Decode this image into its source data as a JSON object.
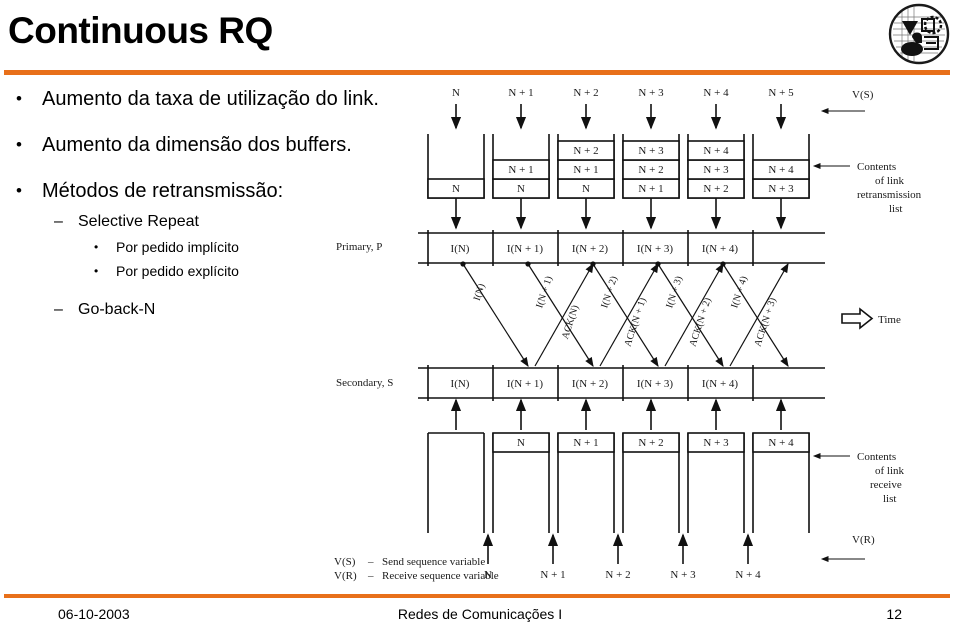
{
  "slide": {
    "title": "Continuous RQ",
    "accent_color": "#E8701A"
  },
  "logo": {
    "name": "faculty-emblem-logo"
  },
  "bullets": [
    {
      "level": 1,
      "marker": "•",
      "text": "Aumento da taxa de utilização do link."
    },
    {
      "level": 1,
      "marker": "•",
      "text": "Aumento da dimensão dos buffers."
    },
    {
      "level": 1,
      "marker": "•",
      "text": "Métodos de retransmissão:"
    },
    {
      "level": 2,
      "marker": "–",
      "text": "Selective Repeat"
    },
    {
      "level": 3,
      "marker": "•",
      "text": "Por pedido implícito"
    },
    {
      "level": 3,
      "marker": "•",
      "text": "Por pedido explícito"
    },
    {
      "level": 2,
      "marker": "–",
      "text": "Go-back-N"
    }
  ],
  "footer": {
    "date": "06-10-2003",
    "course": "Redes de Comunicações I",
    "page": "12"
  },
  "diagram": {
    "top_labels": [
      "N",
      "N + 1",
      "N + 2",
      "N + 3",
      "N + 4",
      "N + 5"
    ],
    "vs_label": "V(S)",
    "vr_label": "V(R)",
    "time_label": "Time",
    "primary_label": "Primary, P",
    "secondary_label": "Secondary, S",
    "retransmission_note": [
      "Contents",
      "of link",
      "retransmission",
      "list"
    ],
    "receive_note": [
      "Contents",
      "of link",
      "receive",
      "list"
    ],
    "tx_stacks": [
      [
        "N"
      ],
      [
        "N",
        "N + 1"
      ],
      [
        "N",
        "N + 1",
        "N + 2"
      ],
      [
        "N + 1",
        "N + 2",
        "N + 3"
      ],
      [
        "N + 2",
        "N + 3",
        "N + 4"
      ],
      [
        "N + 3",
        "N + 4"
      ]
    ],
    "primary_frames": [
      "I(N)",
      "I(N + 1)",
      "I(N + 2)",
      "I(N + 3)",
      "I(N + 4)"
    ],
    "secondary_frames": [
      "I(N)",
      "I(N + 1)",
      "I(N + 2)",
      "I(N + 3)",
      "I(N + 4)"
    ],
    "down_diagonal_labels": [
      "I(N)",
      "I(N + 1)",
      "I(N + 2)",
      "I(N + 3)",
      "I(N + 4)"
    ],
    "up_diagonal_labels": [
      "ACK(N)",
      "ACK(N + 1)",
      "ACK(N + 2)",
      "ACK(N + 3)"
    ],
    "rx_stacks": [
      "",
      "N",
      "N + 1",
      "N + 2",
      "N + 3",
      "N + 4"
    ],
    "bottom_labels": [
      "N",
      "N + 1",
      "N + 2",
      "N + 3",
      "N + 4"
    ],
    "legend": [
      {
        "symbol": "V(S)",
        "eq": "–",
        "desc": "Send sequence variable"
      },
      {
        "symbol": "V(R)",
        "eq": "–",
        "desc": "Receive sequence variable"
      }
    ]
  }
}
